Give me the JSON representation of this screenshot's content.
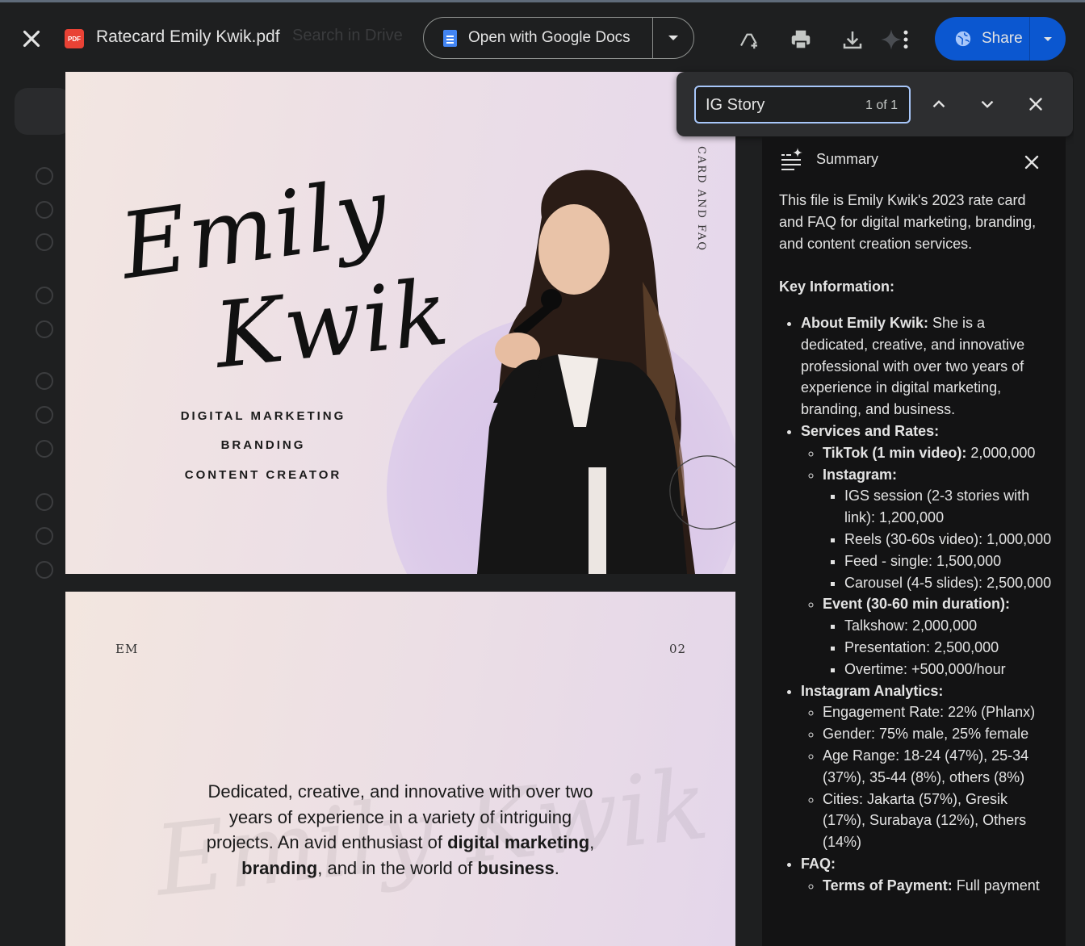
{
  "topbar": {
    "file_title": "Ratecard Emily Kwik.pdf",
    "file_badge": "PDF",
    "background_search_placeholder": "Search in Drive",
    "open_with_label": "Open with Google Docs",
    "share_label": "Share",
    "icons": [
      "close-icon",
      "add-shortcut-icon",
      "print-icon",
      "download-icon",
      "gemini-icon",
      "more-vert-icon",
      "globe-icon"
    ]
  },
  "find": {
    "query": "IG Story",
    "count": "1 of 1"
  },
  "page1": {
    "signature_first": "Emily",
    "signature_last": "Kwik",
    "taglines": [
      "DIGITAL MARKETING",
      "BRANDING",
      "CONTENT CREATOR"
    ],
    "vertical_text": "CARD AND FAQ"
  },
  "page2": {
    "corner_left": "EM",
    "corner_right": "02",
    "body_part1": "Dedicated, creative, and innovative with over two years of experience in a variety of intriguing projects. An avid enthusiast of ",
    "body_bold1": "digital marketing",
    "body_sep1": ", ",
    "body_bold2": "branding",
    "body_sep2": ", and in the world of ",
    "body_bold3": "business",
    "body_end": "."
  },
  "summary": {
    "title": "Summary",
    "intro": "This file is Emily Kwik's 2023 rate card and FAQ for digital marketing, branding, and content creation services.",
    "key_heading": "Key Information:",
    "about_label": "About Emily Kwik:",
    "about_text": " She is a dedicated, creative, and innovative professional with over two years of experience in digital marketing, branding, and business.",
    "services_label": "Services and Rates:",
    "tiktok_label": "TikTok (1 min video):",
    "tiktok_value": " 2,000,000",
    "instagram_label": "Instagram:",
    "instagram_items": [
      "IGS session (2-3 stories with link): 1,200,000",
      "Reels (30-60s video): 1,000,000",
      "Feed - single: 1,500,000",
      "Carousel (4-5 slides): 2,500,000"
    ],
    "event_label": "Event (30-60 min duration):",
    "event_items": [
      "Talkshow: 2,000,000",
      "Presentation: 2,500,000",
      "Overtime: +500,000/hour"
    ],
    "analytics_label": "Instagram Analytics:",
    "analytics_items": [
      "Engagement Rate: 22% (Phlanx)",
      "Gender: 75% male, 25% female",
      "Age Range: 18-24 (47%), 25-34 (37%), 35-44 (8%), others (8%)",
      "Cities: Jakarta (57%), Gresik (17%), Surabaya (12%), Others (14%)"
    ],
    "faq_label": "FAQ:",
    "faq_first_label": "Terms of Payment:",
    "faq_first_text": " Full payment"
  }
}
